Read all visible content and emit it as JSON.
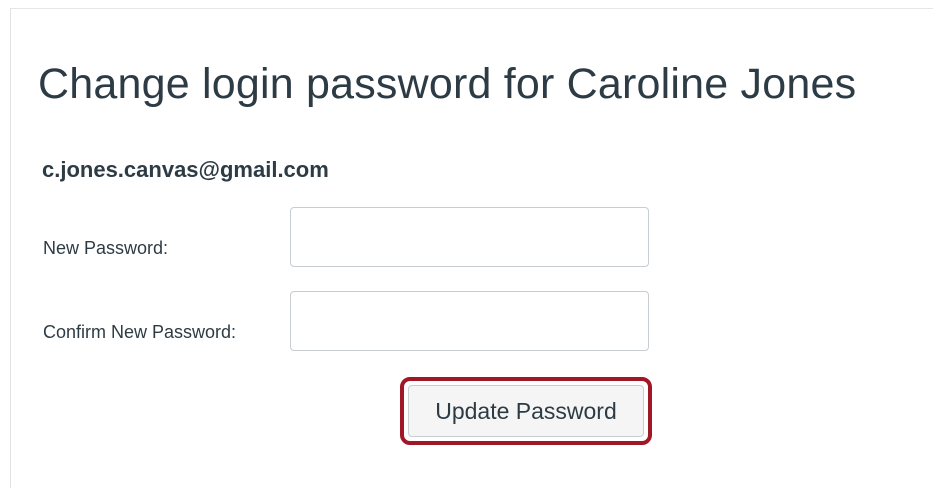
{
  "dialog": {
    "title": "Change login password for Caroline Jones",
    "email": "c.jones.canvas@gmail.com"
  },
  "form": {
    "new_password_label": "New Password:",
    "new_password_value": "",
    "confirm_password_label": "Confirm New Password:",
    "confirm_password_value": "",
    "submit_label": "Update Password"
  },
  "colors": {
    "text": "#2d3b45",
    "highlight_outline": "#a01826",
    "input_border": "#c7cdd1",
    "button_background": "#f5f5f5"
  }
}
